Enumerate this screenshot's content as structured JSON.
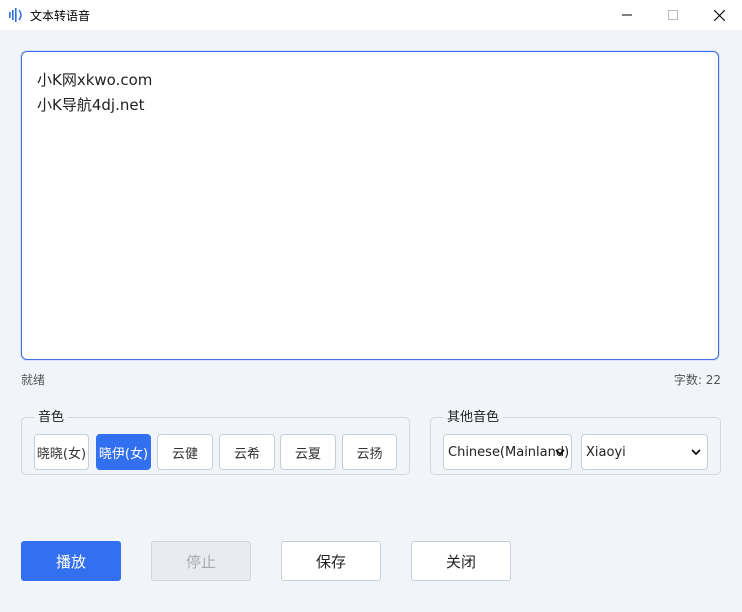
{
  "window": {
    "title": "文本转语音",
    "icon": "sound-wave-icon"
  },
  "editor": {
    "lines": [
      "小K网xkwo.com",
      "小K导航4dj.net"
    ]
  },
  "status": {
    "left": "就绪",
    "right": "字数: 22"
  },
  "voice_group": {
    "legend": "音色",
    "buttons": [
      {
        "label": "晓晓(女)",
        "active": false
      },
      {
        "label": "晓伊(女)",
        "active": true
      },
      {
        "label": "云健",
        "active": false
      },
      {
        "label": "云希",
        "active": false
      },
      {
        "label": "云夏",
        "active": false
      },
      {
        "label": "云扬",
        "active": false
      }
    ]
  },
  "other_group": {
    "legend": "其他音色",
    "language_value": "Chinese(Mainland)",
    "voice_value": "Xiaoyi"
  },
  "actions": {
    "play": "播放",
    "stop": "停止",
    "save": "保存",
    "close": "关闭"
  },
  "colors": {
    "accent": "#3370ef",
    "background": "#f1f4f9"
  }
}
